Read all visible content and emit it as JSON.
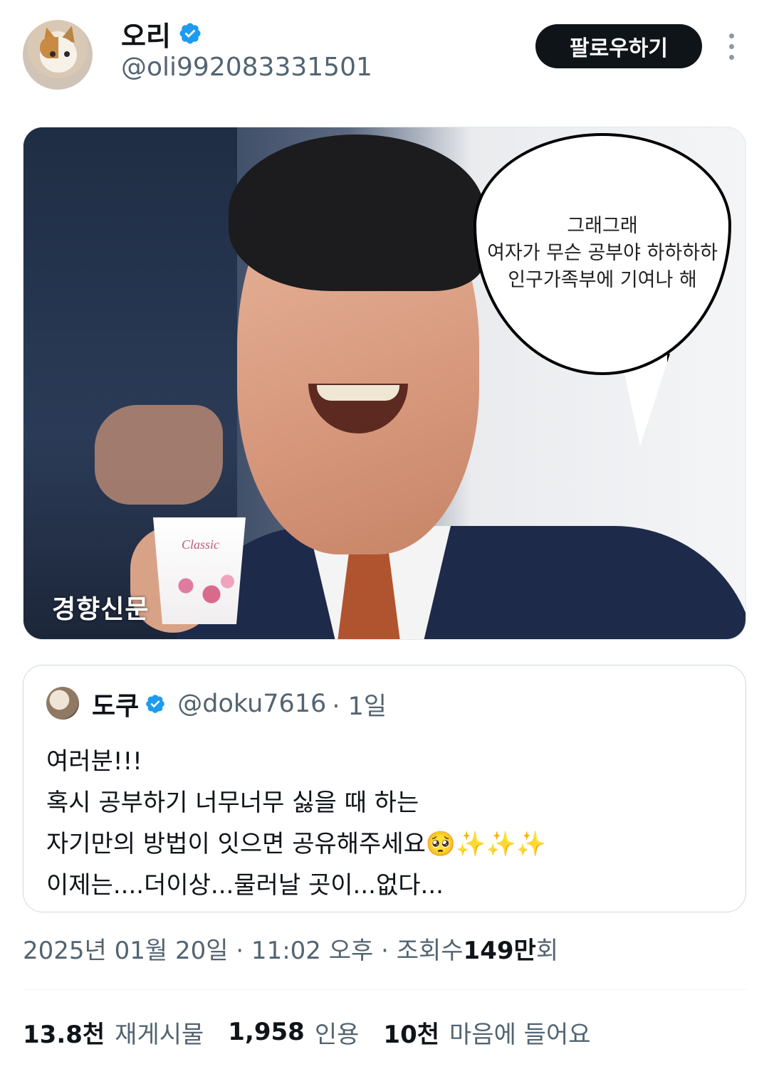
{
  "author": {
    "display_name": "오리",
    "handle": "@oli992083331501",
    "verified": true
  },
  "follow_button_label": "팔로우하기",
  "media": {
    "speech_bubble_lines": [
      "그래그래",
      "여자가 무슨 공부야 하하하하",
      "인구가족부에 기여나 해"
    ],
    "cup_label": "Classic",
    "watermark": "경향신문"
  },
  "quoted_tweet": {
    "display_name": "도쿠",
    "handle": "@doku7616",
    "time": "· 1일",
    "verified": true,
    "lines": [
      "여러분!!!",
      "혹시 공부하기 너무너무 싫을 때 하는",
      "자기만의 방법이 잇으면 공유해주세요🥺✨✨✨",
      "이제는....더이상...물러날 곳이...없다..."
    ]
  },
  "meta": {
    "datetime": "2025년 01월 20일 · 11:02 오후 · 조회수 ",
    "views_count": "149만",
    "views_suffix": "회"
  },
  "stats": {
    "reposts_count": "13.8천",
    "reposts_label": "재게시물",
    "quotes_count": "1,958",
    "quotes_label": "인용",
    "likes_count": "10천",
    "likes_label": "마음에 들어요"
  },
  "colors": {
    "verified_blue": "#1d9bf0",
    "text_primary": "#0f1419",
    "text_secondary": "#536471",
    "button_bg": "#0f1419"
  }
}
